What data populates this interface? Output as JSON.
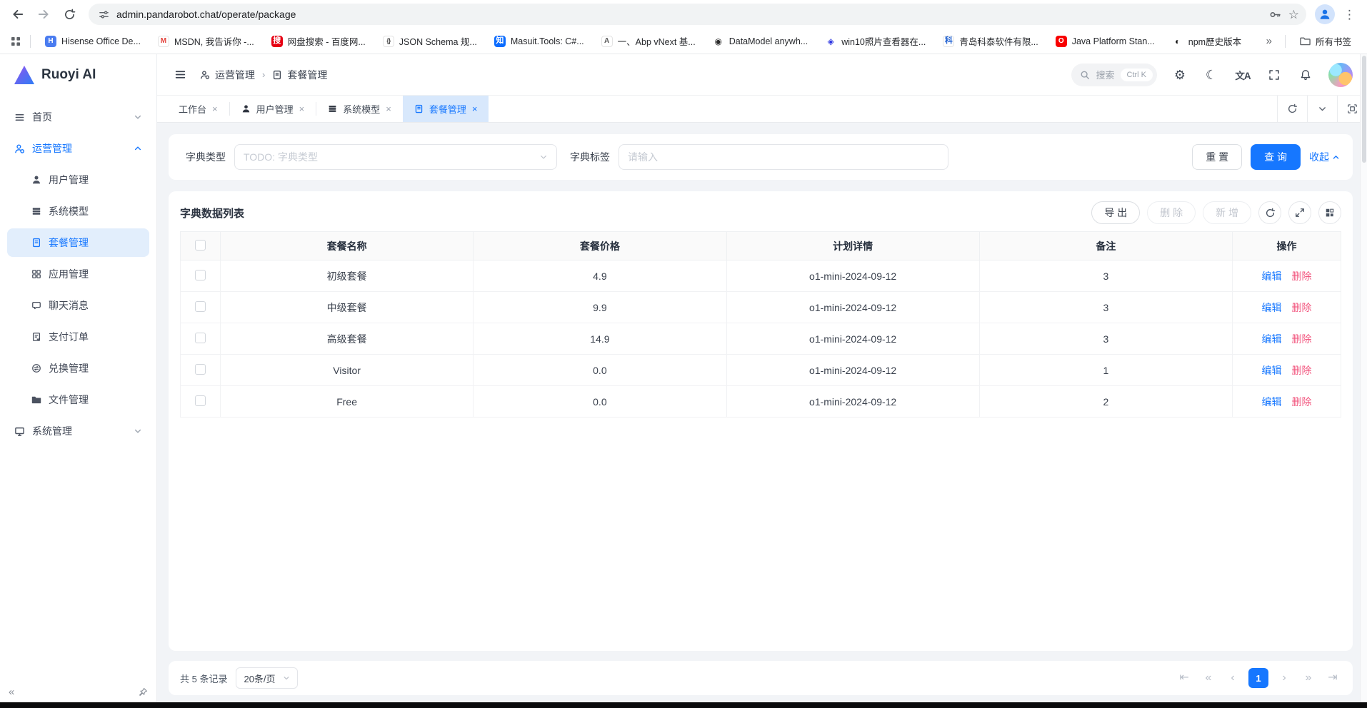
{
  "colors": {
    "accent": "#1677ff",
    "danger": "#f2547d",
    "tab_active_bg": "#d8e8fc",
    "sidebar_active_bg": "#e2eefc",
    "content_bg": "#f2f4f7"
  },
  "icons": {
    "close": "×",
    "star": "☆",
    "overflow_menu": "⋮",
    "gear": "⚙",
    "moon": "☾",
    "translate": "文A",
    "bookmarks_more": "»",
    "sidebar_collapse": "«",
    "pag_first": "⇤",
    "pag_prev_group": "«",
    "pag_prev": "‹",
    "pag_next": "›",
    "pag_next_group": "»",
    "pag_last": "⇥"
  },
  "browser": {
    "url": "admin.pandarobot.chat/operate/package",
    "all_bookmarks_label": "所有书签",
    "bookmarks": [
      {
        "label": "Hisense Office De...",
        "ic": "H",
        "icss": "background:#4a7cf0;color:#fff"
      },
      {
        "label": "MSDN, 我告诉你 -...",
        "ic": "M",
        "icss": "background:#fff;color:#e3413a;border:1px solid #e3e3e3"
      },
      {
        "label": "网盘搜索 - 百度网...",
        "ic": "搜",
        "icss": "background:#e60012;color:#fff;font-size:11px"
      },
      {
        "label": "JSON Schema 规...",
        "ic": "{}",
        "icss": "background:#fff;color:#444;border:1px solid #e3e3e3;font-size:9px;letter-spacing:-1px"
      },
      {
        "label": "Masuit.Tools: C#...",
        "ic": "知",
        "icss": "background:#0b6cff;color:#fff;font-size:11px"
      },
      {
        "label": "一、Abp vNext 基...",
        "ic": "A",
        "icss": "background:#fff;color:#555;border:1px solid #e3e3e3"
      },
      {
        "label": "DataModel anywh...",
        "ic": "◉",
        "icss": "background:#fff;color:#2b2b2b;font-size:12px"
      },
      {
        "label": "win10照片查看器在...",
        "ic": "◈",
        "icss": "background:#fff;color:#2932e1;font-size:12px"
      },
      {
        "label": "青岛科泰软件有限...",
        "ic": "科",
        "icss": "background:#fff;color:#2161d1;border:1px solid #e3e3e3;font-size:11px"
      },
      {
        "label": "Java Platform Stan...",
        "ic": "O",
        "icss": "background:#f80000;color:#fff"
      },
      {
        "label": "npm歷史版本",
        "ic": "◐",
        "icss": "background:#fff;color:#111;font-size:12px"
      }
    ]
  },
  "app": {
    "logo_text": "Ruoyi AI",
    "sidebar": {
      "items": [
        {
          "label": "首页"
        },
        {
          "label": "运营管理"
        },
        {
          "label": "用户管理"
        },
        {
          "label": "系统模型"
        },
        {
          "label": "套餐管理"
        },
        {
          "label": "应用管理"
        },
        {
          "label": "聊天消息"
        },
        {
          "label": "支付订单"
        },
        {
          "label": "兑换管理"
        },
        {
          "label": "文件管理"
        },
        {
          "label": "系统管理"
        }
      ]
    },
    "header": {
      "breadcrumb": [
        "运营管理",
        "套餐管理"
      ],
      "search_label": "搜索",
      "search_shortcut": "Ctrl K"
    },
    "tabs": [
      {
        "label": "工作台"
      },
      {
        "label": "用户管理"
      },
      {
        "label": "系统模型"
      },
      {
        "label": "套餐管理"
      }
    ],
    "filter": {
      "type_label": "字典类型",
      "type_placeholder": "TODO: 字典类型",
      "tag_label": "字典标签",
      "tag_placeholder": "请输入",
      "reset_label": "重 置",
      "query_label": "查 询",
      "collapse_label": "收起"
    },
    "list": {
      "title": "字典数据列表",
      "export_label": "导 出",
      "delete_label": "删 除",
      "add_label": "新 增",
      "columns": [
        "套餐名称",
        "套餐价格",
        "计划详情",
        "备注",
        "操作"
      ],
      "rows": [
        {
          "name": "初级套餐",
          "price": "4.9",
          "plan": "o1-mini-2024-09-12",
          "remark": "3"
        },
        {
          "name": "中级套餐",
          "price": "9.9",
          "plan": "o1-mini-2024-09-12",
          "remark": "3"
        },
        {
          "name": "高级套餐",
          "price": "14.9",
          "plan": "o1-mini-2024-09-12",
          "remark": "3"
        },
        {
          "name": "Visitor",
          "price": "0.0",
          "plan": "o1-mini-2024-09-12",
          "remark": "1"
        },
        {
          "name": "Free",
          "price": "0.0",
          "plan": "o1-mini-2024-09-12",
          "remark": "2"
        }
      ],
      "edit_label": "编辑",
      "delete_row_label": "删除"
    },
    "pagination": {
      "total_label": "共 5 条记录",
      "page_size_label": "20条/页",
      "current_page": "1"
    }
  }
}
